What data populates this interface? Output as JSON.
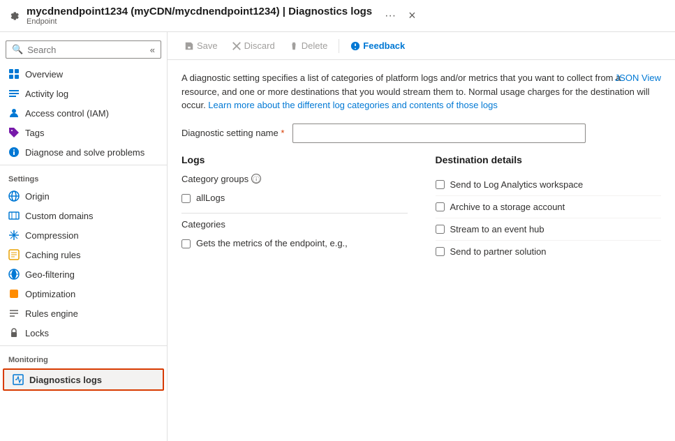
{
  "titleBar": {
    "icon": "gear",
    "title": "mycdnendpoint1234 (myCDN/mycdnendpoint1234) | Diagnostics logs",
    "subtitle": "Endpoint",
    "ellipsis": "···",
    "close": "×"
  },
  "sidebar": {
    "search_placeholder": "Search",
    "collapse_icon": "«",
    "nav_items": [
      {
        "id": "overview",
        "label": "Overview",
        "icon": "overview"
      },
      {
        "id": "activity-log",
        "label": "Activity log",
        "icon": "activity"
      },
      {
        "id": "access-control",
        "label": "Access control (IAM)",
        "icon": "iam"
      },
      {
        "id": "tags",
        "label": "Tags",
        "icon": "tags"
      },
      {
        "id": "diagnose",
        "label": "Diagnose and solve problems",
        "icon": "diagnose"
      }
    ],
    "settings_label": "Settings",
    "settings_items": [
      {
        "id": "origin",
        "label": "Origin",
        "icon": "origin"
      },
      {
        "id": "custom-domains",
        "label": "Custom domains",
        "icon": "domains"
      },
      {
        "id": "compression",
        "label": "Compression",
        "icon": "compression"
      },
      {
        "id": "caching-rules",
        "label": "Caching rules",
        "icon": "caching"
      },
      {
        "id": "geo-filtering",
        "label": "Geo-filtering",
        "icon": "geo"
      },
      {
        "id": "optimization",
        "label": "Optimization",
        "icon": "optimization"
      },
      {
        "id": "rules-engine",
        "label": "Rules engine",
        "icon": "rules"
      },
      {
        "id": "locks",
        "label": "Locks",
        "icon": "locks"
      }
    ],
    "monitoring_label": "Monitoring",
    "monitoring_items": [
      {
        "id": "diagnostics-logs",
        "label": "Diagnostics logs",
        "icon": "diagnostics",
        "active": true
      }
    ]
  },
  "toolbar": {
    "save_label": "Save",
    "discard_label": "Discard",
    "delete_label": "Delete",
    "feedback_label": "Feedback"
  },
  "content": {
    "description": "A diagnostic setting specifies a list of categories of platform logs and/or metrics that you want to collect from a resource, and one or more destinations that you would stream them to. Normal usage charges for the destination will occur. ",
    "link_text": "Learn more about the different log categories and contents of those logs",
    "json_view_label": "JSON View",
    "field_label": "Diagnostic setting name",
    "required_mark": "*",
    "field_placeholder": "",
    "logs_title": "Logs",
    "category_groups_label": "Category groups",
    "info_icon": "ⓘ",
    "category_groups": [
      {
        "id": "allLogs",
        "label": "allLogs",
        "checked": false
      }
    ],
    "categories_label": "Categories",
    "categories": [
      {
        "id": "metrics",
        "label": "Gets the metrics of the endpoint, e.g.,",
        "checked": false
      }
    ],
    "destination_title": "Destination details",
    "destinations": [
      {
        "id": "log-analytics",
        "label": "Send to Log Analytics workspace",
        "checked": false
      },
      {
        "id": "storage-account",
        "label": "Archive to a storage account",
        "checked": false
      },
      {
        "id": "event-hub",
        "label": "Stream to an event hub",
        "checked": false
      },
      {
        "id": "partner-solution",
        "label": "Send to partner solution",
        "checked": false
      }
    ]
  }
}
